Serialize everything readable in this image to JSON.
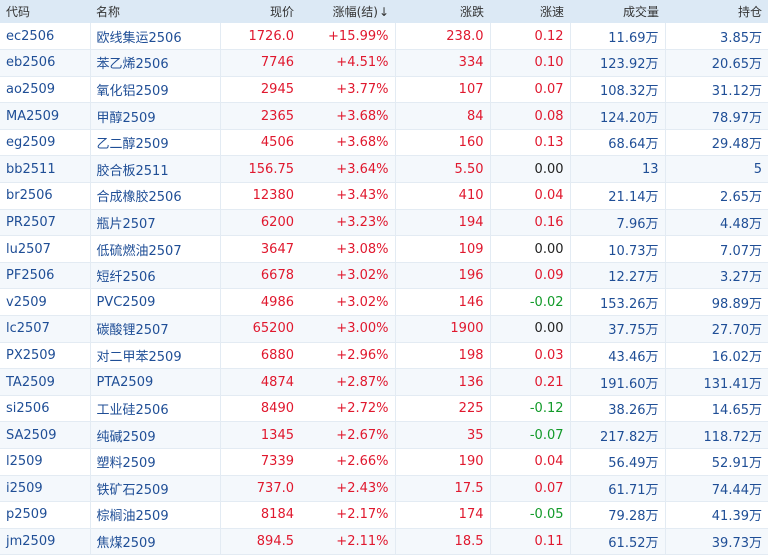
{
  "colors": {
    "up": "#e0182e",
    "down": "#129a29",
    "flat": "#222222",
    "link": "#1f4e96",
    "header_bg": "#dce9f5"
  },
  "headers": {
    "code": "代码",
    "name": "名称",
    "price": "现价",
    "change_pct": "涨幅(结)",
    "sort_icon": "↓",
    "change": "涨跌",
    "speed": "涨速",
    "volume": "成交量",
    "open_interest": "持仓"
  },
  "rows": [
    {
      "code": "ec2506",
      "name": "欧线集运2506",
      "price": "1726.0",
      "pct": "+15.99%",
      "chg": "238.0",
      "speed": "0.12",
      "vol": "11.69万",
      "oi": "3.85万",
      "speed_dir": "up"
    },
    {
      "code": "eb2506",
      "name": "苯乙烯2506",
      "price": "7746",
      "pct": "+4.51%",
      "chg": "334",
      "speed": "0.10",
      "vol": "123.92万",
      "oi": "20.65万",
      "speed_dir": "up"
    },
    {
      "code": "ao2509",
      "name": "氧化铝2509",
      "price": "2945",
      "pct": "+3.77%",
      "chg": "107",
      "speed": "0.07",
      "vol": "108.32万",
      "oi": "31.12万",
      "speed_dir": "up"
    },
    {
      "code": "MA2509",
      "name": "甲醇2509",
      "price": "2365",
      "pct": "+3.68%",
      "chg": "84",
      "speed": "0.08",
      "vol": "124.20万",
      "oi": "78.97万",
      "speed_dir": "up"
    },
    {
      "code": "eg2509",
      "name": "乙二醇2509",
      "price": "4506",
      "pct": "+3.68%",
      "chg": "160",
      "speed": "0.13",
      "vol": "68.64万",
      "oi": "29.48万",
      "speed_dir": "up"
    },
    {
      "code": "bb2511",
      "name": "胶合板2511",
      "price": "156.75",
      "pct": "+3.64%",
      "chg": "5.50",
      "speed": "0.00",
      "vol": "13",
      "oi": "5",
      "speed_dir": "flat"
    },
    {
      "code": "br2506",
      "name": "合成橡胶2506",
      "price": "12380",
      "pct": "+3.43%",
      "chg": "410",
      "speed": "0.04",
      "vol": "21.14万",
      "oi": "2.65万",
      "speed_dir": "up"
    },
    {
      "code": "PR2507",
      "name": "瓶片2507",
      "price": "6200",
      "pct": "+3.23%",
      "chg": "194",
      "speed": "0.16",
      "vol": "7.96万",
      "oi": "4.48万",
      "speed_dir": "up"
    },
    {
      "code": "lu2507",
      "name": "低硫燃油2507",
      "price": "3647",
      "pct": "+3.08%",
      "chg": "109",
      "speed": "0.00",
      "vol": "10.73万",
      "oi": "7.07万",
      "speed_dir": "flat"
    },
    {
      "code": "PF2506",
      "name": "短纤2506",
      "price": "6678",
      "pct": "+3.02%",
      "chg": "196",
      "speed": "0.09",
      "vol": "12.27万",
      "oi": "3.27万",
      "speed_dir": "up"
    },
    {
      "code": "v2509",
      "name": "PVC2509",
      "price": "4986",
      "pct": "+3.02%",
      "chg": "146",
      "speed": "-0.02",
      "vol": "153.26万",
      "oi": "98.89万",
      "speed_dir": "down"
    },
    {
      "code": "lc2507",
      "name": "碳酸锂2507",
      "price": "65200",
      "pct": "+3.00%",
      "chg": "1900",
      "speed": "0.00",
      "vol": "37.75万",
      "oi": "27.70万",
      "speed_dir": "flat"
    },
    {
      "code": "PX2509",
      "name": "对二甲苯2509",
      "price": "6880",
      "pct": "+2.96%",
      "chg": "198",
      "speed": "0.03",
      "vol": "43.46万",
      "oi": "16.02万",
      "speed_dir": "up"
    },
    {
      "code": "TA2509",
      "name": "PTA2509",
      "price": "4874",
      "pct": "+2.87%",
      "chg": "136",
      "speed": "0.21",
      "vol": "191.60万",
      "oi": "131.41万",
      "speed_dir": "up"
    },
    {
      "code": "si2506",
      "name": "工业硅2506",
      "price": "8490",
      "pct": "+2.72%",
      "chg": "225",
      "speed": "-0.12",
      "vol": "38.26万",
      "oi": "14.65万",
      "speed_dir": "down"
    },
    {
      "code": "SA2509",
      "name": "纯碱2509",
      "price": "1345",
      "pct": "+2.67%",
      "chg": "35",
      "speed": "-0.07",
      "vol": "217.82万",
      "oi": "118.72万",
      "speed_dir": "down"
    },
    {
      "code": "l2509",
      "name": "塑料2509",
      "price": "7339",
      "pct": "+2.66%",
      "chg": "190",
      "speed": "0.04",
      "vol": "56.49万",
      "oi": "52.91万",
      "speed_dir": "up"
    },
    {
      "code": "i2509",
      "name": "铁矿石2509",
      "price": "737.0",
      "pct": "+2.43%",
      "chg": "17.5",
      "speed": "0.07",
      "vol": "61.71万",
      "oi": "74.44万",
      "speed_dir": "up"
    },
    {
      "code": "p2509",
      "name": "棕榈油2509",
      "price": "8184",
      "pct": "+2.17%",
      "chg": "174",
      "speed": "-0.05",
      "vol": "79.28万",
      "oi": "41.39万",
      "speed_dir": "down"
    },
    {
      "code": "jm2509",
      "name": "焦煤2509",
      "price": "894.5",
      "pct": "+2.11%",
      "chg": "18.5",
      "speed": "0.11",
      "vol": "61.52万",
      "oi": "39.73万",
      "speed_dir": "up"
    }
  ]
}
